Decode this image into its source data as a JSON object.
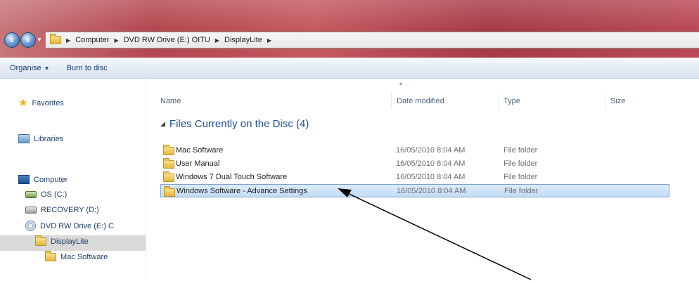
{
  "address_bar": {
    "crumbs": [
      "Computer",
      "DVD RW Drive (E:) OITU",
      "DisplayLite"
    ]
  },
  "toolbar": {
    "organise_label": "Organise",
    "burn_label": "Burn to disc"
  },
  "nav": {
    "favorites": "Favorites",
    "libraries": "Libraries",
    "computer": "Computer",
    "drive_c": "OS (C:)",
    "drive_d": "RECOVERY (D:)",
    "drive_e": "DVD RW Drive (E:) C",
    "displaylite": "DisplayLite",
    "mac_software": "Mac Software"
  },
  "columns": {
    "name": "Name",
    "date_modified": "Date modified",
    "type": "Type",
    "size": "Size"
  },
  "group": {
    "title": "Files Currently on the Disc (4)"
  },
  "files": [
    {
      "name": "Mac Software",
      "date": "16/05/2010 8:04 AM",
      "type": "File folder"
    },
    {
      "name": "User Manual",
      "date": "16/05/2010 8:04 AM",
      "type": "File folder"
    },
    {
      "name": "Windows 7 Dual Touch Software",
      "date": "16/05/2010 8:04 AM",
      "type": "File folder"
    },
    {
      "name": "Windows Software - Advance Settings",
      "date": "16/05/2010 8:04 AM",
      "type": "File folder"
    }
  ],
  "colors": {
    "title_red": "#b4474f",
    "selection_blue": "#c3dcf6",
    "group_text": "#1e4f9b"
  }
}
